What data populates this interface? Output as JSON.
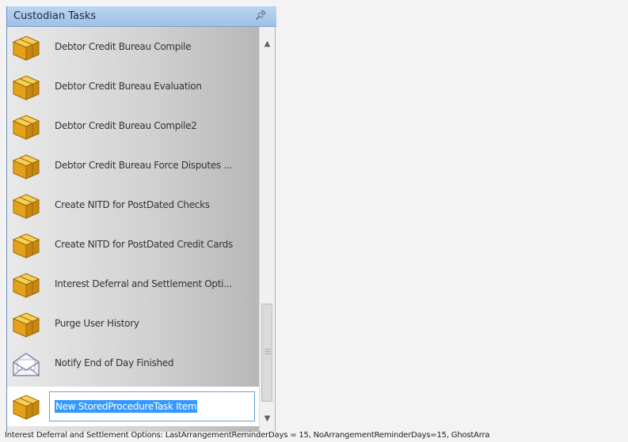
{
  "panel": {
    "title": "Custodian Tasks",
    "pin_icon": "pin-icon",
    "tasks": [
      {
        "label": "Debtor Credit Bureau Compile",
        "icon": "package-box-icon"
      },
      {
        "label": "Debtor Credit Bureau Evaluation",
        "icon": "package-box-icon"
      },
      {
        "label": "Debtor Credit Bureau Compile2",
        "icon": "package-box-icon"
      },
      {
        "label": "Debtor Credit Bureau Force Disputes ...",
        "icon": "package-box-icon"
      },
      {
        "label": "Create NITD for PostDated Checks",
        "icon": "package-box-icon"
      },
      {
        "label": "Create NITD for PostDated Credit Cards",
        "icon": "package-box-icon"
      },
      {
        "label": "Interest Deferral and Settlement Opti...",
        "icon": "package-box-icon"
      },
      {
        "label": "Purge User History",
        "icon": "package-box-icon"
      },
      {
        "label": "Notify End of Day Finished",
        "icon": "envelope-icon"
      }
    ],
    "editing_task": {
      "value": "New StoredProcedureTask Item",
      "icon": "package-box-icon"
    }
  },
  "status_bar": {
    "text": "Interest Deferral and Settlement Options: LastArrangementReminderDays = 15, NoArrangementReminderDays=15, GhostArra"
  },
  "colors": {
    "header": "#a9c8ec",
    "selection": "#3399ff",
    "box_gold": "#e3a21a"
  }
}
